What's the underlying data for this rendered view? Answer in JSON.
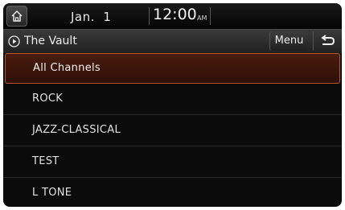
{
  "status": {
    "date": "Jan.  1",
    "time": "12:00",
    "ampm": "AM"
  },
  "title_bar": {
    "title": "The Vault",
    "menu_label": "Menu"
  },
  "channels": [
    {
      "label": "All Channels",
      "selected": true
    },
    {
      "label": "ROCK",
      "selected": false
    },
    {
      "label": "JAZZ-CLASSICAL",
      "selected": false
    },
    {
      "label": "TEST",
      "selected": false
    },
    {
      "label": "L TONE",
      "selected": false
    }
  ],
  "colors": {
    "selected_border": "#c0552a",
    "selected_bg": "#4a1d10",
    "background": "#0b0b0b"
  },
  "icons": {
    "home": "home-icon",
    "play": "play-circle-icon",
    "back": "back-arrow-icon"
  }
}
